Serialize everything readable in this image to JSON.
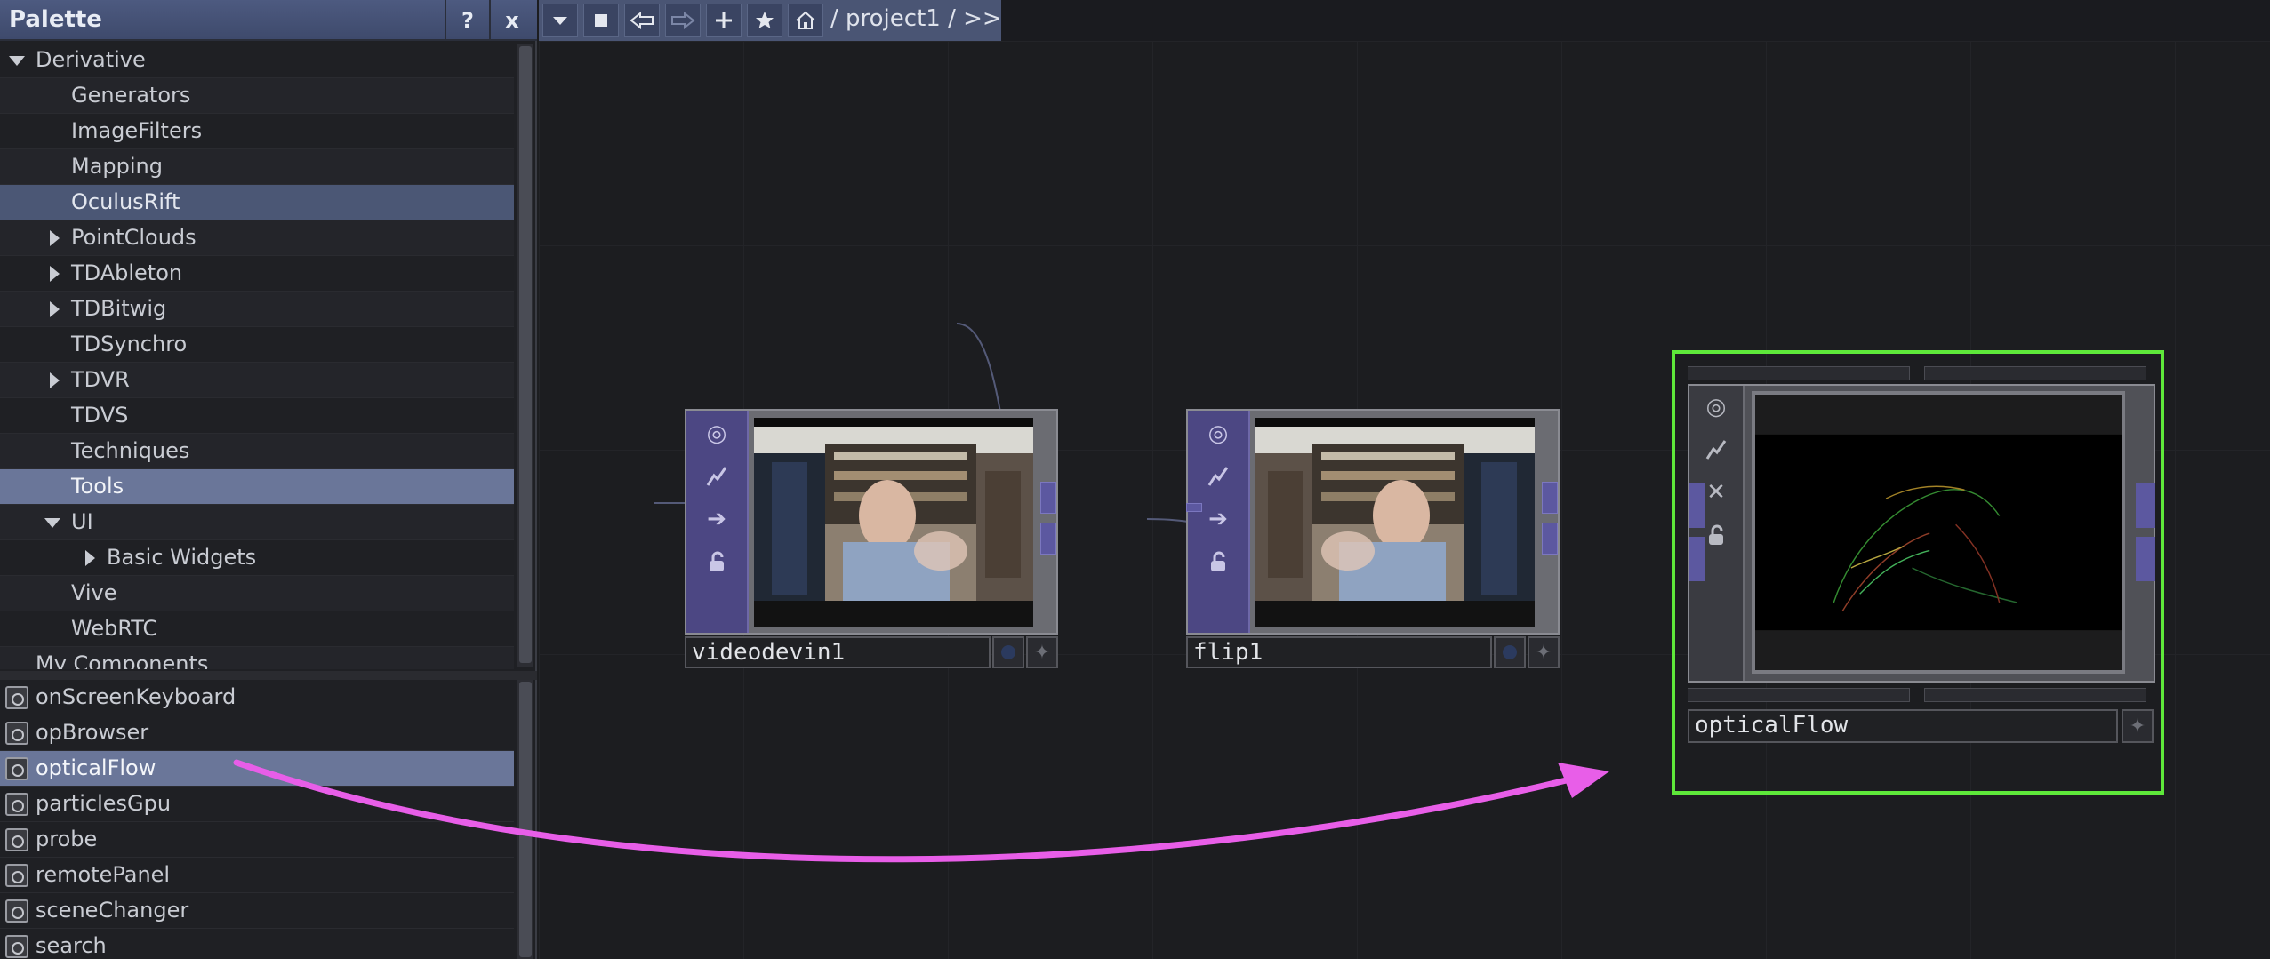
{
  "palette": {
    "title": "Palette",
    "help_label": "?",
    "close_label": "x",
    "tree": [
      {
        "label": "Derivative",
        "expand": "open"
      },
      {
        "label": "Generators"
      },
      {
        "label": "ImageFilters"
      },
      {
        "label": "Mapping"
      },
      {
        "label": "OculusRift"
      },
      {
        "label": "PointClouds",
        "expand": "closed"
      },
      {
        "label": "TDAbleton",
        "expand": "closed"
      },
      {
        "label": "TDBitwig",
        "expand": "closed"
      },
      {
        "label": "TDSynchro"
      },
      {
        "label": "TDVR",
        "expand": "closed"
      },
      {
        "label": "TDVS"
      },
      {
        "label": "Techniques"
      },
      {
        "label": "Tools"
      },
      {
        "label": "UI",
        "expand": "open"
      },
      {
        "label": "Basic Widgets",
        "expand": "closed"
      },
      {
        "label": "Vive"
      },
      {
        "label": "WebRTC"
      },
      {
        "label": "My Components"
      }
    ],
    "components": [
      {
        "label": "onScreenKeyboard"
      },
      {
        "label": "opBrowser"
      },
      {
        "label": "opticalFlow"
      },
      {
        "label": "particlesGpu"
      },
      {
        "label": "probe"
      },
      {
        "label": "remotePanel"
      },
      {
        "label": "sceneChanger"
      },
      {
        "label": "search"
      }
    ]
  },
  "toolbar": {
    "path": "/ project1 / >>",
    "icons": [
      "dropdown-icon",
      "stop-icon",
      "back-icon",
      "forward-icon",
      "add-icon",
      "star-icon",
      "home-icon"
    ]
  },
  "nodes": {
    "videodevin": {
      "name": "videodevin1"
    },
    "flip": {
      "name": "flip1"
    },
    "opticalflow": {
      "name": "opticalFlow"
    }
  },
  "colors": {
    "accent_selected": "#6a7699",
    "top_operator": "#4c4783",
    "selected_node_outline": "#5ee83a",
    "drag_arrow": "#e85ee8"
  }
}
